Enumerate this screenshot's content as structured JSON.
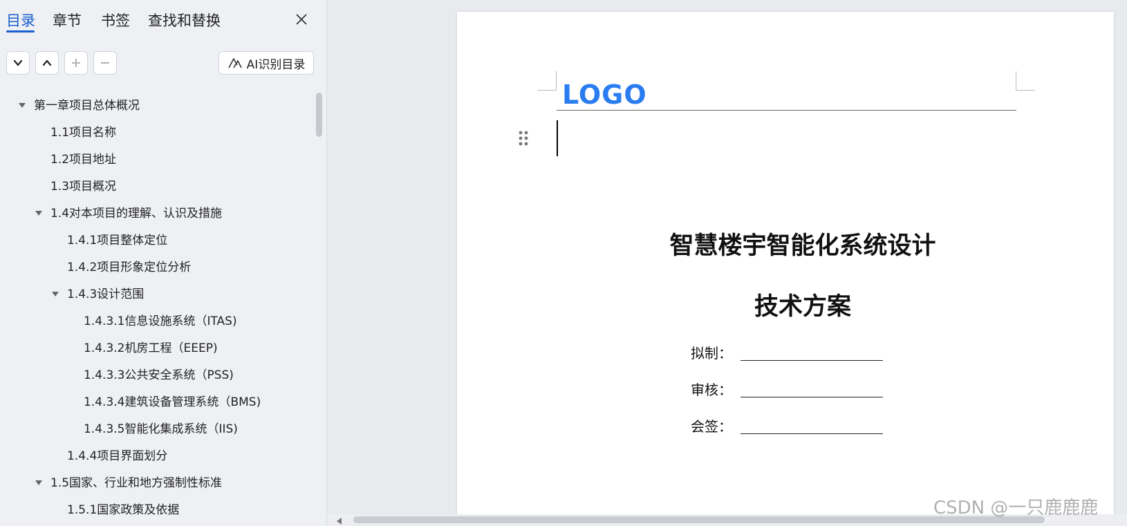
{
  "tabs": [
    {
      "label": "目录",
      "active": true
    },
    {
      "label": "章节",
      "active": false
    },
    {
      "label": "书签",
      "active": false
    },
    {
      "label": "查找和替换",
      "active": false
    }
  ],
  "toolbar": {
    "expand_icon": "chevron-down-icon",
    "collapse_icon": "chevron-up-icon",
    "add_icon": "plus-icon",
    "remove_icon": "minus-icon",
    "ai_button_label": "AI识别目录"
  },
  "toc": [
    {
      "text": "第一章项目总体概况",
      "level": 0,
      "caret": true
    },
    {
      "text": "1.1项目名称",
      "level": 1,
      "caret": false
    },
    {
      "text": "1.2项目地址",
      "level": 1,
      "caret": false
    },
    {
      "text": "1.3项目概况",
      "level": 1,
      "caret": false
    },
    {
      "text": "1.4对本项目的理解、认识及措施",
      "level": 1,
      "caret": true
    },
    {
      "text": "1.4.1项目整体定位",
      "level": 2,
      "caret": false
    },
    {
      "text": "1.4.2项目形象定位分析",
      "level": 2,
      "caret": false
    },
    {
      "text": "1.4.3设计范围",
      "level": 2,
      "caret": true
    },
    {
      "text": "1.4.3.1信息设施系统（ITAS)",
      "level": 3,
      "caret": false
    },
    {
      "text": "1.4.3.2机房工程（EEEP)",
      "level": 3,
      "caret": false
    },
    {
      "text": "1.4.3.3公共安全系统（PSS)",
      "level": 3,
      "caret": false
    },
    {
      "text": "1.4.3.4建筑设备管理系统（BMS)",
      "level": 3,
      "caret": false
    },
    {
      "text": "1.4.3.5智能化集成系统（IIS)",
      "level": 3,
      "caret": false
    },
    {
      "text": "1.4.4项目界面划分",
      "level": 2,
      "caret": false
    },
    {
      "text": "1.5国家、行业和地方强制性标准",
      "level": 1,
      "caret": true
    },
    {
      "text": "1.5.1国家政策及依据",
      "level": 2,
      "caret": false
    }
  ],
  "document": {
    "logo_text": "LOGO",
    "logo_color": "#2a7df0",
    "title": "智慧楼宇智能化系统设计",
    "subtitle": "技术方案",
    "fields": [
      {
        "label": "拟制："
      },
      {
        "label": "审核："
      },
      {
        "label": "会签："
      }
    ]
  },
  "watermark": "CSDN @一只鹿鹿鹿",
  "colors": {
    "accent": "#1a5fd0"
  }
}
